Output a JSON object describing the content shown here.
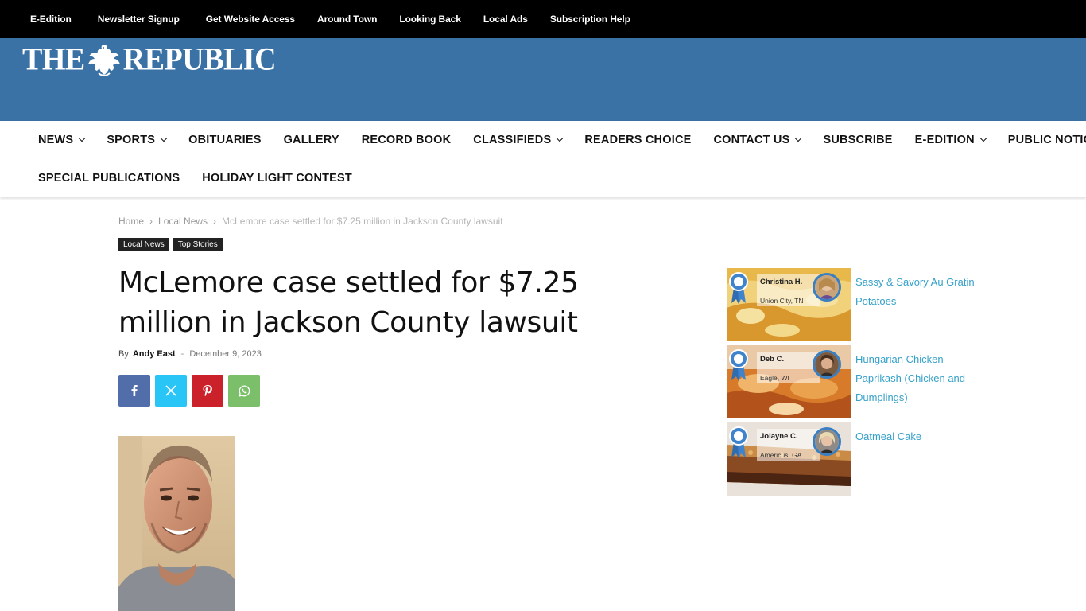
{
  "topbar": {
    "links": [
      "E-Edition",
      "Newsletter Signup",
      "Get Website Access",
      "Around Town",
      "Looking Back",
      "Local Ads",
      "Subscription Help"
    ]
  },
  "header": {
    "logo_left": "THE",
    "logo_right": "REPUBLIC",
    "bg_color": "#3a72a5"
  },
  "nav": {
    "row1": [
      {
        "label": "NEWS",
        "dropdown": true
      },
      {
        "label": "SPORTS",
        "dropdown": true
      },
      {
        "label": "OBITUARIES",
        "dropdown": false
      },
      {
        "label": "GALLERY",
        "dropdown": false
      },
      {
        "label": "RECORD BOOK",
        "dropdown": false
      },
      {
        "label": "CLASSIFIEDS",
        "dropdown": true
      },
      {
        "label": "READERS CHOICE",
        "dropdown": false
      },
      {
        "label": "CONTACT US",
        "dropdown": true
      },
      {
        "label": "SUBSCRIBE",
        "dropdown": false
      },
      {
        "label": "E-EDITION",
        "dropdown": true
      },
      {
        "label": "PUBLIC NOTICES",
        "dropdown": false
      }
    ],
    "row2": [
      {
        "label": "SPECIAL PUBLICATIONS",
        "dropdown": false
      },
      {
        "label": "HOLIDAY LIGHT CONTEST",
        "dropdown": false
      }
    ]
  },
  "breadcrumb": {
    "home": "Home",
    "section": "Local News",
    "current": "McLemore case settled for $7.25 million in Jackson County lawsuit",
    "separator": "›"
  },
  "tags": [
    "Local News",
    "Top Stories"
  ],
  "article": {
    "title": "McLemore case settled for $7.25 million in Jackson County lawsuit",
    "by": "By",
    "author": "Andy East",
    "dash": "-",
    "date": "December 9, 2023"
  },
  "share": {
    "buttons": [
      "facebook-icon",
      "x-icon",
      "pinterest-icon",
      "whatsapp-icon"
    ],
    "colors": {
      "facebook": "#516eab",
      "x": "#29c5f6",
      "pinterest": "#ca212a",
      "whatsapp": "#7bbf6a"
    }
  },
  "recipes": [
    {
      "name": "Christina H.",
      "location": "Union City, TN",
      "title": "Sassy & Savory Au Gratin Potatoes"
    },
    {
      "name": "Deb C.",
      "location": "Eagle, WI",
      "title": "Hungarian Chicken Paprikash (Chicken and Dumplings)"
    },
    {
      "name": "Jolayne C.",
      "location": "Americus, GA",
      "title": "Oatmeal Cake"
    }
  ],
  "link_color": "#35a1c9"
}
